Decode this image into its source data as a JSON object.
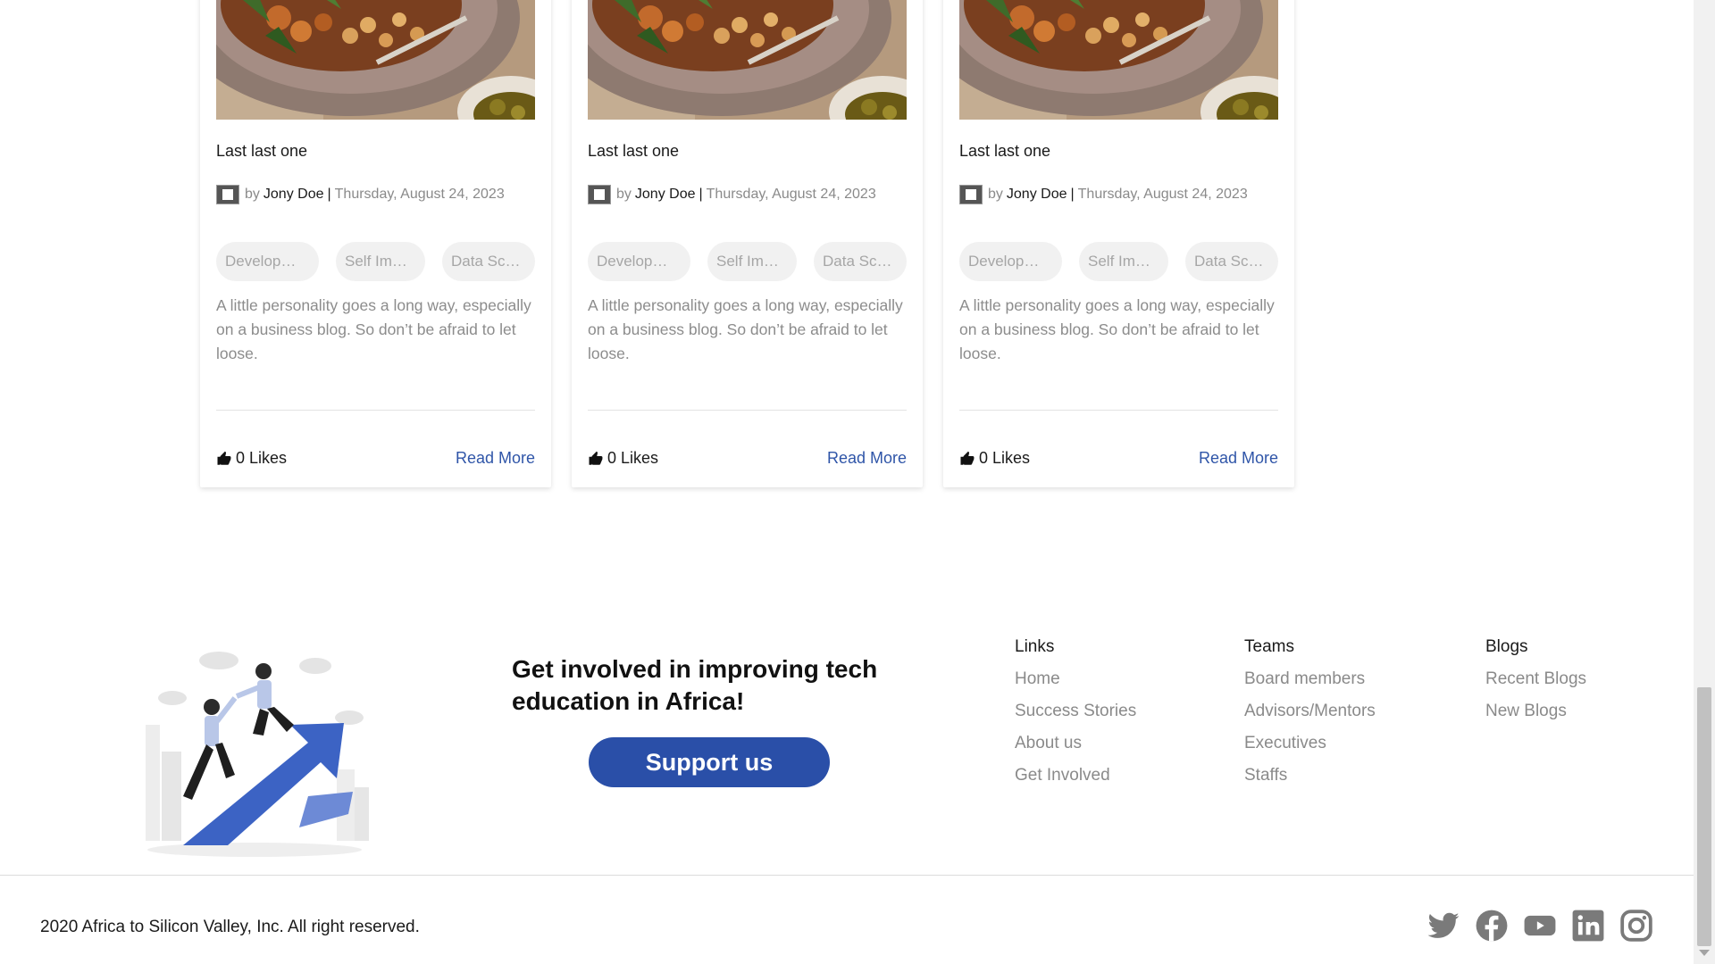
{
  "cards": [
    {
      "title": "Last last one",
      "by": "by",
      "author": "Jony Doe",
      "separator": "|",
      "date": "Thursday, August 24, 2023",
      "tags": [
        "Develop…",
        "Self Im…",
        "Data Sc…"
      ],
      "excerpt": "A little personality goes a long way, especially on a business blog. So don’t be afraid to let loose.",
      "likes": "0 Likes",
      "read_more": "Read More"
    },
    {
      "title": "Last last one",
      "by": "by",
      "author": "Jony Doe",
      "separator": "|",
      "date": "Thursday, August 24, 2023",
      "tags": [
        "Develop…",
        "Self Im…",
        "Data Sc…"
      ],
      "excerpt": "A little personality goes a long way, especially on a business blog. So don’t be afraid to let loose.",
      "likes": "0 Likes",
      "read_more": "Read More"
    },
    {
      "title": "Last last one",
      "by": "by",
      "author": "Jony Doe",
      "separator": "|",
      "date": "Thursday, August 24, 2023",
      "tags": [
        "Develop…",
        "Self Im…",
        "Data Sc…"
      ],
      "excerpt": "A little personality goes a long way, especially on a business blog. So don’t be afraid to let loose.",
      "likes": "0 Likes",
      "read_more": "Read More"
    }
  ],
  "footer": {
    "cta_text": "Get involved in improving tech education in Africa!",
    "support_button": "Support us",
    "columns": [
      {
        "heading": "Links",
        "items": [
          "Home",
          "Success Stories",
          "About us",
          "Get Involved"
        ]
      },
      {
        "heading": "Teams",
        "items": [
          "Board members",
          "Advisors/Mentors",
          "Executives",
          "Staffs"
        ]
      },
      {
        "heading": "Blogs",
        "items": [
          "Recent Blogs",
          "New Blogs"
        ]
      }
    ],
    "copyright": "2020 Africa to Silicon Valley, Inc. All right reserved.",
    "social_icons": [
      "twitter-icon",
      "facebook-icon",
      "youtube-icon",
      "linkedin-icon",
      "instagram-icon"
    ]
  },
  "colors": {
    "accent": "#2a4fa8",
    "link": "#2f55a8",
    "muted_text": "#8a8a8a",
    "social_icon": "#7a7a7a"
  }
}
